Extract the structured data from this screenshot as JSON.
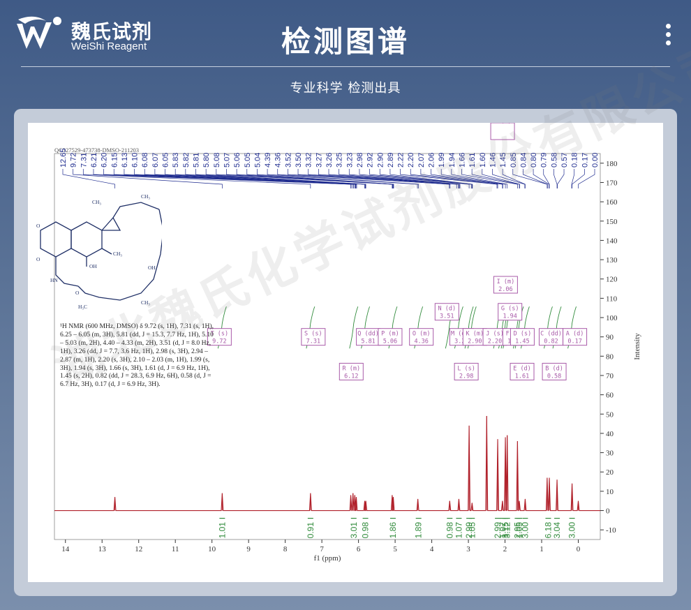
{
  "header": {
    "logo_cn": "魏氏试剂",
    "logo_en": "WeiShi Reagent",
    "title": "检测图谱",
    "subtitle": "专业科学  检测出具"
  },
  "watermark": "湖北魏氏化学试剂股份有限公司",
  "sample_id": "QC327529-473738-DMSO-211203",
  "nmr_description": "¹H NMR (600 MHz, DMSO) δ 9.72 (s, 1H), 7.31 (s, 1H), 6.25 – 6.05 (m, 3H), 5.81 (dd, J = 15.3, 7.7 Hz, 1H), 5.10 – 5.03 (m, 2H), 4.40 – 4.33 (m, 2H), 3.51 (d, J = 8.0 Hz, 1H), 3.26 (dd, J = 7.7, 3.6 Hz, 1H), 2.98 (s, 3H), 2.94 – 2.87 (m, 1H), 2.20 (s, 3H), 2.10 – 2.03 (m, 1H), 1.99 (s, 3H), 1.94 (s, 3H), 1.66 (s, 3H), 1.61 (d, J = 6.9 Hz, 1H), 1.45 (s, 2H), 0.82 (dd, J = 28.3, 6.9 Hz, 6H), 0.58 (d, J = 6.7 Hz, 3H), 0.17 (d, J = 6.9 Hz, 3H).",
  "chart_data": {
    "type": "line",
    "title": "",
    "xlabel": "f1 (ppm)",
    "ylabel": "Intensity",
    "xlim": [
      14.3,
      -0.6
    ],
    "ylim": [
      -15,
      185
    ],
    "x_ticks": [
      "14",
      "13",
      "12",
      "11",
      "10",
      "9",
      "8",
      "7",
      "6",
      "5",
      "4",
      "3",
      "2",
      "1",
      "0"
    ],
    "y_ticks": [
      "-10",
      "0",
      "10",
      "20",
      "30",
      "40",
      "50",
      "60",
      "70",
      "80",
      "90",
      "100",
      "110",
      "120",
      "130",
      "140",
      "150",
      "160",
      "170",
      "180"
    ],
    "peak_labels": [
      "12.65",
      "9.72",
      "7.31",
      "6.21",
      "6.20",
      "6.15",
      "6.13",
      "6.10",
      "6.08",
      "6.07",
      "6.05",
      "5.83",
      "5.82",
      "5.81",
      "5.80",
      "5.08",
      "5.07",
      "5.06",
      "5.05",
      "5.04",
      "4.39",
      "4.36",
      "3.52",
      "3.50",
      "3.32",
      "3.27",
      "3.26",
      "3.25",
      "3.23",
      "2.98",
      "2.92",
      "2.90",
      "2.89",
      "2.22",
      "2.20",
      "2.07",
      "2.06",
      "1.99",
      "1.94",
      "1.66",
      "1.61",
      "1.60",
      "1.46",
      "1.45",
      "0.85",
      "0.84",
      "0.80",
      "0.79",
      "0.58",
      "0.57",
      "0.18",
      "0.17",
      "0.00"
    ],
    "peaks": [
      {
        "ppm": 12.65,
        "height": 7
      },
      {
        "ppm": 9.72,
        "height": 9
      },
      {
        "ppm": 7.31,
        "height": 9
      },
      {
        "ppm": 6.21,
        "height": 8
      },
      {
        "ppm": 6.15,
        "height": 9
      },
      {
        "ppm": 6.1,
        "height": 8
      },
      {
        "ppm": 6.06,
        "height": 7
      },
      {
        "ppm": 5.83,
        "height": 5
      },
      {
        "ppm": 5.8,
        "height": 5
      },
      {
        "ppm": 5.08,
        "height": 8
      },
      {
        "ppm": 5.05,
        "height": 7
      },
      {
        "ppm": 4.38,
        "height": 6
      },
      {
        "ppm": 3.51,
        "height": 5
      },
      {
        "ppm": 3.26,
        "height": 6
      },
      {
        "ppm": 2.98,
        "height": 44
      },
      {
        "ppm": 2.9,
        "height": 4
      },
      {
        "ppm": 2.5,
        "height": 49
      },
      {
        "ppm": 2.2,
        "height": 37
      },
      {
        "ppm": 2.07,
        "height": 5
      },
      {
        "ppm": 1.99,
        "height": 38
      },
      {
        "ppm": 1.94,
        "height": 39
      },
      {
        "ppm": 1.66,
        "height": 36
      },
      {
        "ppm": 1.61,
        "height": 5
      },
      {
        "ppm": 1.45,
        "height": 6
      },
      {
        "ppm": 0.85,
        "height": 17
      },
      {
        "ppm": 0.79,
        "height": 17
      },
      {
        "ppm": 0.58,
        "height": 16
      },
      {
        "ppm": 0.17,
        "height": 14
      },
      {
        "ppm": 0.0,
        "height": 5
      }
    ],
    "integrals": [
      {
        "ppm": 9.72,
        "value": "1.01"
      },
      {
        "ppm": 7.31,
        "value": "0.91"
      },
      {
        "ppm": 6.13,
        "value": "3.01"
      },
      {
        "ppm": 5.81,
        "value": "0.98"
      },
      {
        "ppm": 5.06,
        "value": "1.86"
      },
      {
        "ppm": 4.36,
        "value": "1.89"
      },
      {
        "ppm": 3.51,
        "value": "0.98"
      },
      {
        "ppm": 3.26,
        "value": "1.07"
      },
      {
        "ppm": 2.98,
        "value": "2.99"
      },
      {
        "ppm": 2.9,
        "value": "1.05"
      },
      {
        "ppm": 2.2,
        "value": "2.99"
      },
      {
        "ppm": 2.06,
        "value": "1.07"
      },
      {
        "ppm": 1.99,
        "value": "3.15"
      },
      {
        "ppm": 1.94,
        "value": "3.12"
      },
      {
        "ppm": 1.66,
        "value": "2.95"
      },
      {
        "ppm": 1.61,
        "value": "1.05"
      },
      {
        "ppm": 1.45,
        "value": "3.00"
      },
      {
        "ppm": 0.82,
        "value": "6.18"
      },
      {
        "ppm": 0.58,
        "value": "3.04"
      },
      {
        "ppm": 0.17,
        "value": "3.00"
      }
    ],
    "multiplets": [
      {
        "id": "T",
        "type": "s",
        "shift": "9.72"
      },
      {
        "id": "S",
        "type": "s",
        "shift": "7.31"
      },
      {
        "id": "R",
        "type": "m",
        "shift": "6.12"
      },
      {
        "id": "Q",
        "type": "dd",
        "shift": "5.81"
      },
      {
        "id": "P",
        "type": "m",
        "shift": "5.06"
      },
      {
        "id": "O",
        "type": "m",
        "shift": "4.36"
      },
      {
        "id": "N",
        "type": "d",
        "shift": "3.51"
      },
      {
        "id": "M",
        "type": "dd",
        "shift": "3.26"
      },
      {
        "id": "L",
        "type": "s",
        "shift": "2.98"
      },
      {
        "id": "K",
        "type": "m",
        "shift": "2.90"
      },
      {
        "id": "J",
        "type": "s",
        "shift": "2.20"
      },
      {
        "id": "I",
        "type": "m",
        "shift": "2.06"
      },
      {
        "id": "H",
        "type": "s",
        "shift": "1.99"
      },
      {
        "id": "G",
        "type": "s",
        "shift": "1.94"
      },
      {
        "id": "F",
        "type": "s",
        "shift": "1.66"
      },
      {
        "id": "E",
        "type": "d",
        "shift": "1.61"
      },
      {
        "id": "D",
        "type": "s",
        "shift": "1.45"
      },
      {
        "id": "C",
        "type": "dd",
        "shift": "0.82"
      },
      {
        "id": "B",
        "type": "d",
        "shift": "0.58"
      },
      {
        "id": "A",
        "type": "d",
        "shift": "0.17"
      }
    ],
    "colors": {
      "spectrum": "#b0202a",
      "peak_labels": "#1f2c8f",
      "integral": "#2f8a3a",
      "box": "#a85aa8",
      "axis": "#333333"
    }
  }
}
